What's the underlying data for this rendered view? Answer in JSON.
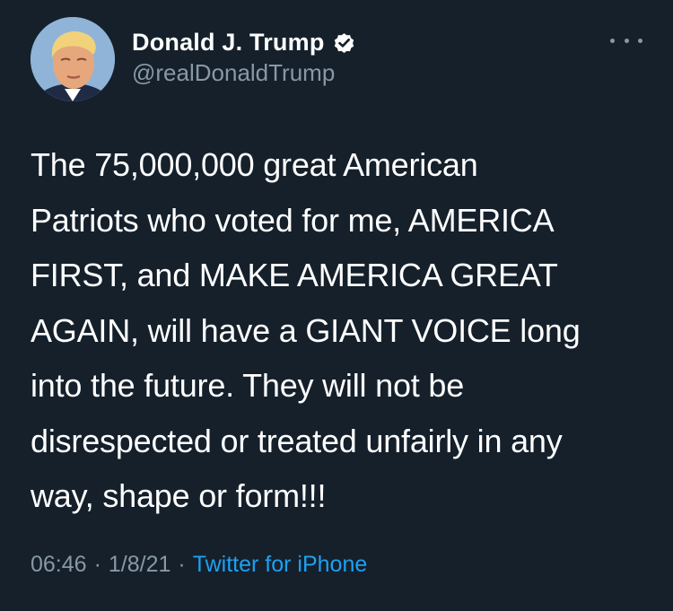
{
  "user": {
    "display_name": "Donald J. Trump",
    "handle": "@realDonaldTrump",
    "verified": true,
    "avatar": "profile-photo"
  },
  "tweet": {
    "text": "The 75,000,000 great American\nPatriots who voted for me, AMERICA\nFIRST, and MAKE AMERICA GREAT\nAGAIN, will have a GIANT VOICE long\ninto the future. They will not be\ndisrespected or treated unfairly in any\nway, shape or form!!!",
    "time": "06:46",
    "date": "1/8/21",
    "separator": "·",
    "source": "Twitter for iPhone"
  },
  "icons": {
    "verified": "verified-badge-icon",
    "more": "more-options-icon"
  },
  "colors": {
    "background": "#15202b",
    "text": "#ffffff",
    "secondary": "#8899a6",
    "link": "#1da1f2"
  }
}
